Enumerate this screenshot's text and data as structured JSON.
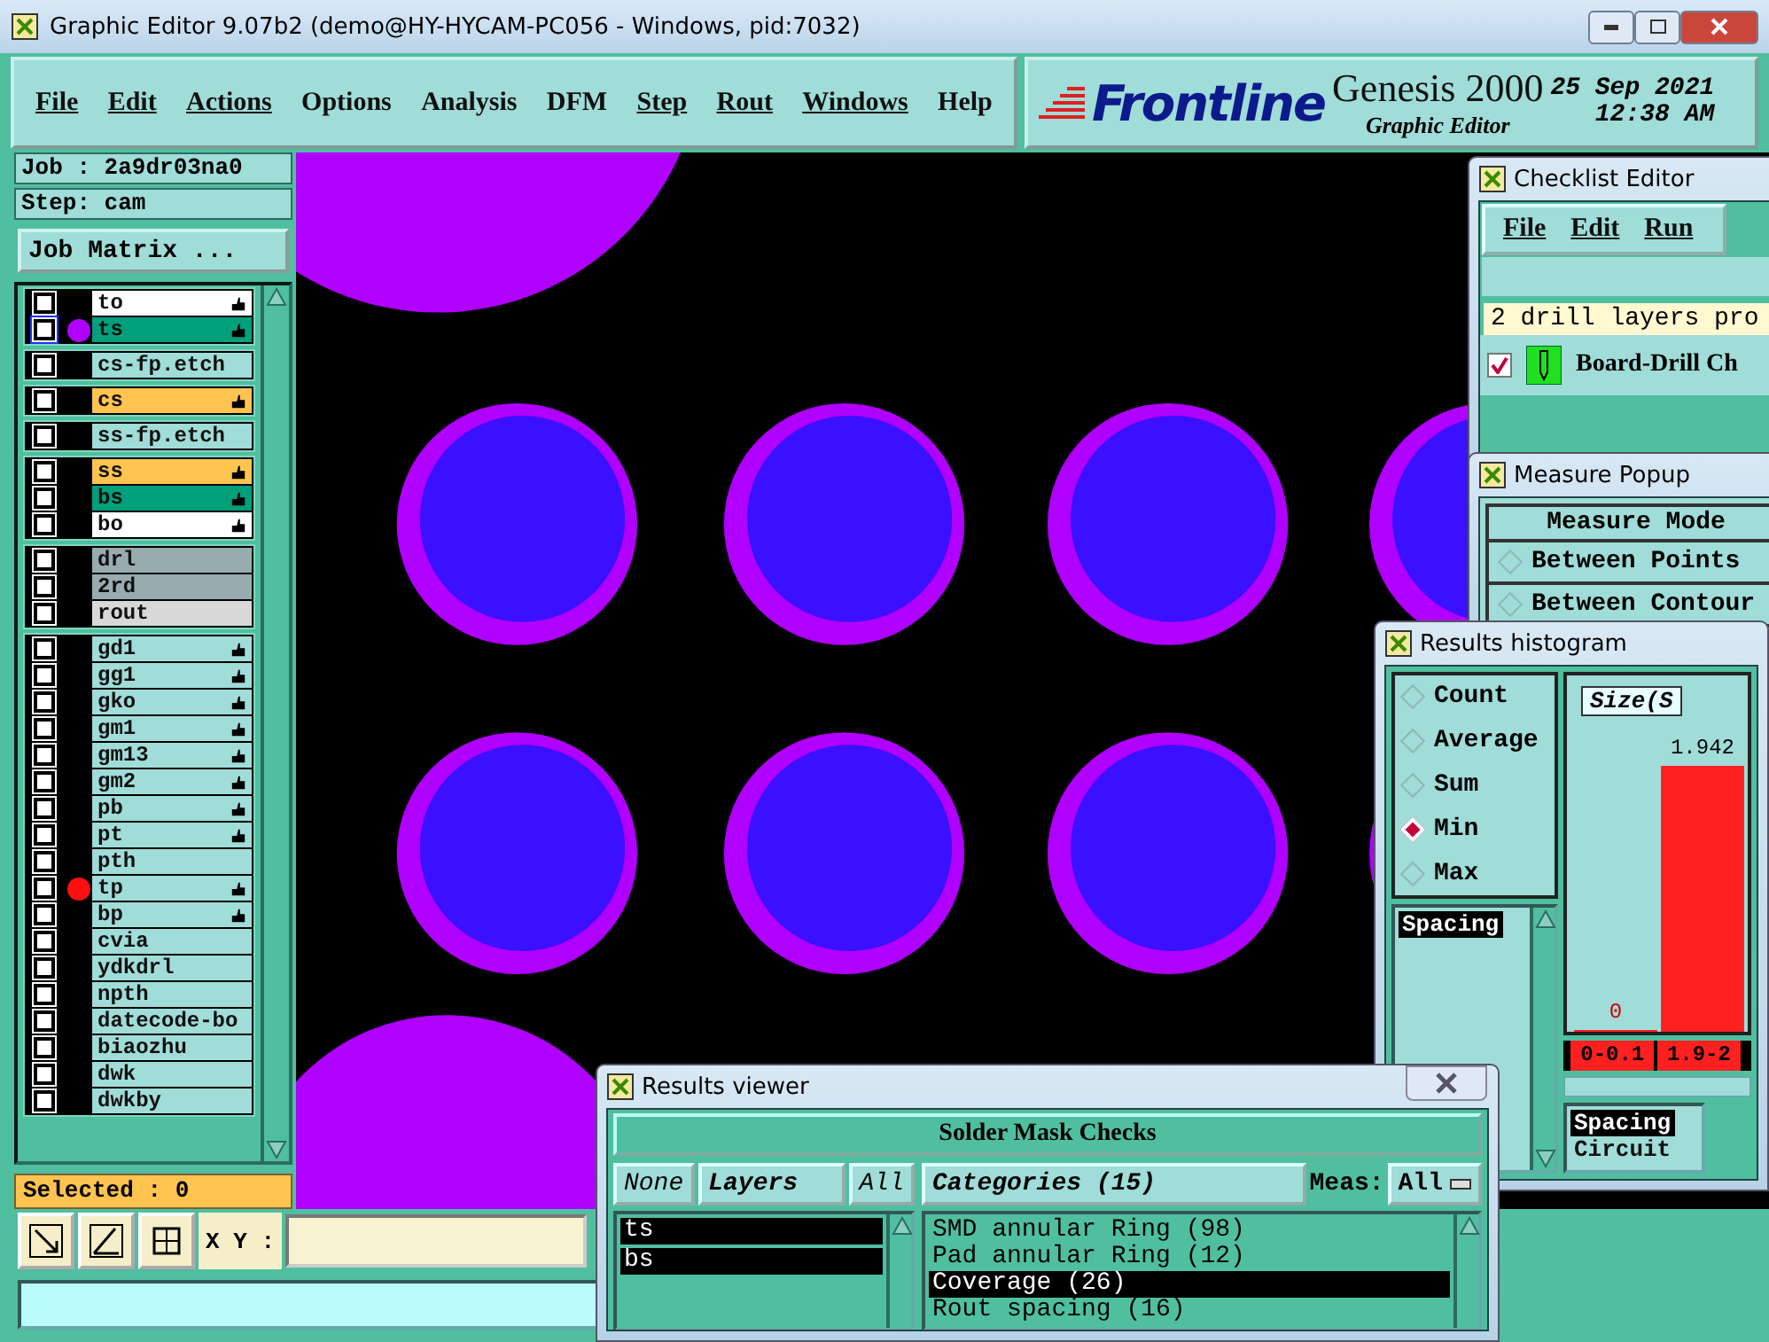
{
  "window": {
    "title": "Graphic Editor 9.07b2 (demo@HY-HYCAM-PC056 - Windows, pid:7032)"
  },
  "menu": [
    "File",
    "Edit",
    "Actions",
    "Options",
    "Analysis",
    "DFM",
    "Step",
    "Rout",
    "Windows",
    "Help"
  ],
  "branding": {
    "logo": "Frontline",
    "product": "Genesis 2000",
    "subtitle": "Graphic Editor",
    "date": "25 Sep 2021",
    "time": "12:38 AM"
  },
  "job_panel": {
    "job": "Job : 2a9dr03na0",
    "step": "Step: cam",
    "matrix_button": "Job Matrix ...",
    "selected_count": "Selected : 0",
    "groups": [
      {
        "layers": [
          {
            "name": "to",
            "color": "#ffffff",
            "editable": true,
            "focused": false
          },
          {
            "name": "ts",
            "color": "#00a07a",
            "editable": true,
            "focused": true,
            "dot": {
              "color": "#b000ff"
            }
          }
        ]
      },
      {
        "layers": [
          {
            "name": "cs-fp.etch",
            "color": "#a0dcd8",
            "editable": false,
            "focused": false
          }
        ]
      },
      {
        "layers": [
          {
            "name": "cs",
            "color": "#ffc450",
            "editable": true,
            "focused": false
          }
        ]
      },
      {
        "layers": [
          {
            "name": "ss-fp.etch",
            "color": "#a0dcd8",
            "editable": false,
            "focused": false
          }
        ]
      },
      {
        "layers": [
          {
            "name": "ss",
            "color": "#ffc450",
            "editable": true,
            "focused": false
          },
          {
            "name": "bs",
            "color": "#00a07a",
            "editable": true,
            "focused": false
          },
          {
            "name": "bo",
            "color": "#ffffff",
            "editable": true,
            "focused": false
          }
        ]
      },
      {
        "layers": [
          {
            "name": "drl",
            "color": "#98acb0",
            "editable": false,
            "focused": false
          },
          {
            "name": "2rd",
            "color": "#98acb0",
            "editable": false,
            "focused": false
          },
          {
            "name": "rout",
            "color": "#d8d8d8",
            "editable": false,
            "focused": false
          }
        ]
      },
      {
        "layers": [
          {
            "name": "gd1",
            "color": "#a0dcd8",
            "editable": true,
            "focused": false
          },
          {
            "name": "gg1",
            "color": "#a0dcd8",
            "editable": true,
            "focused": false
          },
          {
            "name": "gko",
            "color": "#a0dcd8",
            "editable": true,
            "focused": false
          },
          {
            "name": "gm1",
            "color": "#a0dcd8",
            "editable": true,
            "focused": false
          },
          {
            "name": "gm13",
            "color": "#a0dcd8",
            "editable": true,
            "focused": false
          },
          {
            "name": "gm2",
            "color": "#a0dcd8",
            "editable": true,
            "focused": false
          },
          {
            "name": "pb",
            "color": "#a0dcd8",
            "editable": true,
            "focused": false
          },
          {
            "name": "pt",
            "color": "#a0dcd8",
            "editable": true,
            "focused": false
          },
          {
            "name": "pth",
            "color": "#a0dcd8",
            "editable": false,
            "focused": false
          },
          {
            "name": "tp",
            "color": "#a0dcd8",
            "editable": true,
            "focused": false,
            "dot": {
              "color": "#ff1010"
            }
          },
          {
            "name": "bp",
            "color": "#a0dcd8",
            "editable": true,
            "focused": false
          },
          {
            "name": "cvia",
            "color": "#a0dcd8",
            "editable": false,
            "focused": false
          },
          {
            "name": "ydkdrl",
            "color": "#a0dcd8",
            "editable": false,
            "focused": false
          },
          {
            "name": "npth",
            "color": "#a0dcd8",
            "editable": false,
            "focused": false
          },
          {
            "name": "datecode-bo",
            "color": "#a0dcd8",
            "editable": false,
            "focused": false
          },
          {
            "name": "biaozhu",
            "color": "#a0dcd8",
            "editable": false,
            "focused": false
          },
          {
            "name": "dwk",
            "color": "#a0dcd8",
            "editable": false,
            "focused": false
          },
          {
            "name": "dwkby",
            "color": "#a0dcd8",
            "editable": false,
            "focused": false
          }
        ]
      }
    ]
  },
  "toolbar": {
    "xy_label": "X Y :"
  },
  "checklist_editor": {
    "title": "Checklist Editor",
    "menu": [
      "File",
      "Edit",
      "Run"
    ],
    "message": "2 drill layers pro",
    "item": {
      "label": "Board-Drill Ch",
      "checked": true
    }
  },
  "measure_popup": {
    "title": "Measure Popup",
    "heading": "Measure Mode",
    "modes": [
      {
        "label": "Between Points",
        "selected": false
      },
      {
        "label": "Between Contour",
        "selected": false
      }
    ]
  },
  "results_histogram": {
    "title": "Results histogram",
    "modes": [
      {
        "label": "Count",
        "selected": false
      },
      {
        "label": "Average",
        "selected": false
      },
      {
        "label": "Sum",
        "selected": false
      },
      {
        "label": "Min",
        "selected": true
      },
      {
        "label": "Max",
        "selected": false
      }
    ],
    "measures": [
      {
        "label": "Spacing",
        "selected": true
      }
    ],
    "chart_data": {
      "type": "bar",
      "title": "Size(S",
      "categories": [
        "0-0.1",
        "1.9-2"
      ],
      "values": [
        0,
        1.942
      ],
      "data_labels": true
    },
    "categories": [
      {
        "label": "Spacing",
        "selected": true
      },
      {
        "label": "Circuit",
        "selected": false
      }
    ]
  },
  "results_viewer": {
    "title": "Results viewer",
    "heading": "Solder Mask Checks",
    "none_button": "None",
    "layers_button": "Layers",
    "all_button": "All",
    "layers": [
      {
        "name": "ts",
        "selected": true
      },
      {
        "name": "bs",
        "selected": true
      }
    ],
    "categories_button": "Categories (15)",
    "meas_label": "Meas:",
    "meas_value": "All",
    "categories": [
      {
        "label": "SMD annular Ring (98)",
        "selected": false
      },
      {
        "label": "Pad annular Ring (12)",
        "selected": false
      },
      {
        "label": "Coverage (26)",
        "selected": true
      },
      {
        "label": "Rout spacing (16)",
        "selected": false
      }
    ]
  }
}
